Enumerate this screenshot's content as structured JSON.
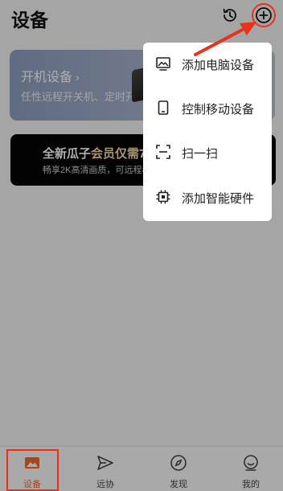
{
  "header": {
    "title": "设备",
    "history_icon": "history-icon",
    "add_icon": "plus-circle-icon"
  },
  "cards": {
    "power_on": {
      "title": "开机设备",
      "chevron": "›",
      "subtitle": "任性远程开关机、定时开"
    },
    "promo": {
      "title_prefix": "全新瓜子",
      "title_highlight": "会员仅需",
      "title_suffix": "7",
      "subtitle": "畅享2K高清画质，可远程移"
    }
  },
  "menu": {
    "items": [
      {
        "label": "添加电脑设备",
        "icon": "monitor-icon"
      },
      {
        "label": "控制移动设备",
        "icon": "phone-icon"
      },
      {
        "label": "扫一扫",
        "icon": "scan-icon"
      },
      {
        "label": "添加智能硬件",
        "icon": "chip-icon"
      }
    ]
  },
  "bottom_nav": {
    "items": [
      {
        "label": "设备",
        "icon": "device-icon",
        "active": true
      },
      {
        "label": "远协",
        "icon": "send-icon",
        "active": false
      },
      {
        "label": "发现",
        "icon": "compass-icon",
        "active": false
      },
      {
        "label": "我的",
        "icon": "profile-icon",
        "active": false
      }
    ]
  },
  "colors": {
    "accent": "#f06a2a",
    "annotation_red": "#e8321c",
    "overlay": "rgba(0,0,0,0.32)"
  }
}
